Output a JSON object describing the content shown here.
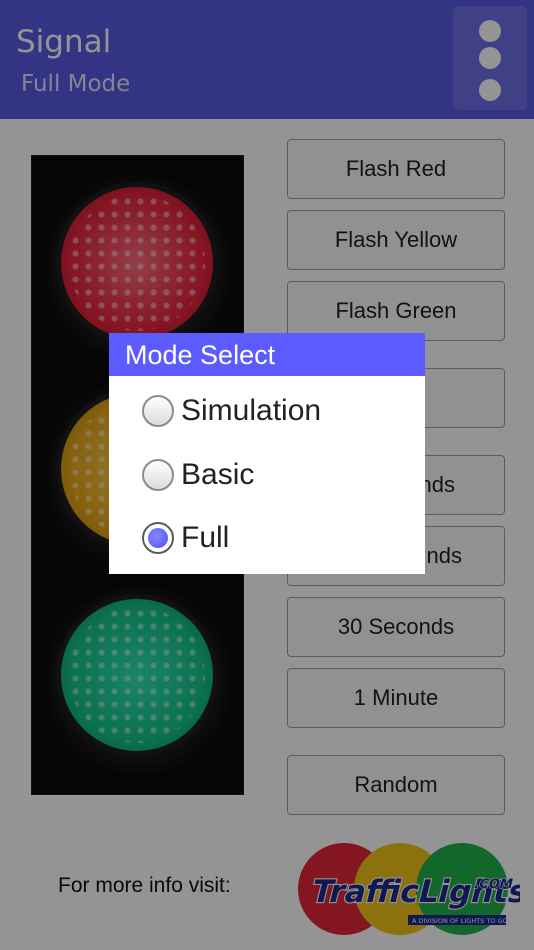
{
  "header": {
    "title": "Signal",
    "subtitle": "Full Mode",
    "menu_icon": "overflow-menu-icon"
  },
  "colors": {
    "header_bg": "#5a5ae6",
    "dialog_title_bg": "#5b5bff",
    "radio_selected": "#5050ff",
    "lamp_red": "#e8263f",
    "lamp_yellow": "#e8a91a",
    "lamp_green": "#14c48c"
  },
  "signal": {
    "lamps": [
      "red",
      "yellow",
      "green"
    ]
  },
  "buttons": [
    "Flash Red",
    "Flash Yellow",
    "Flash Green",
    "",
    "",
    "",
    "30 Seconds",
    "1 Minute",
    "Random"
  ],
  "partial_button_text": {
    "btn5": "nds",
    "btn6": "nds"
  },
  "footer": {
    "text": "For more info visit:",
    "logo_text": "TrafficLights.com",
    "logo_tagline": "A DIVISION OF LIGHTS TO GO INC."
  },
  "dialog": {
    "title": "Mode Select",
    "options": [
      {
        "label": "Simulation",
        "selected": false
      },
      {
        "label": "Basic",
        "selected": false
      },
      {
        "label": "Full",
        "selected": true
      }
    ]
  }
}
